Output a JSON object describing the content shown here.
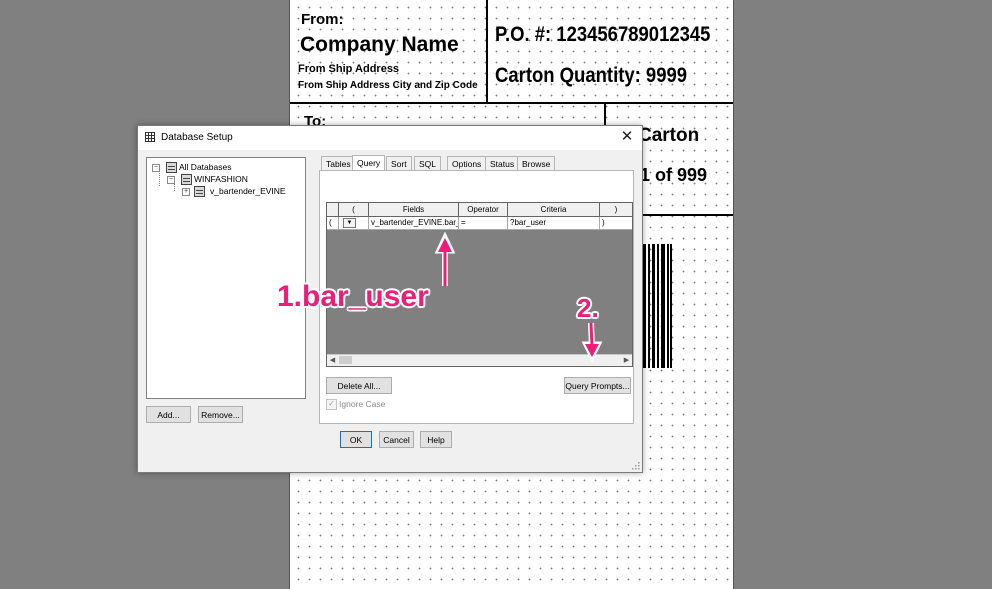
{
  "label": {
    "from_label": "From:",
    "company_name": "Company Name",
    "from_address": "From Ship Address",
    "from_city_zip": "From Ship Address City and Zip Code",
    "po": "P.O. #: 123456789012345",
    "carton_quantity": "Carton Quantity:  9999",
    "to_label": "To:",
    "carton_word": "Carton",
    "carton_count": "1 of 999"
  },
  "dialog": {
    "title": "Database Setup",
    "close_glyph": "✕",
    "tree": [
      {
        "label": "All Databases",
        "expander": "−"
      },
      {
        "label": "WINFASHION",
        "expander": "−"
      },
      {
        "label": "v_bartender_EVINE",
        "expander": "+"
      }
    ],
    "add_button": "Add...",
    "remove_button": "Remove...",
    "tabs": [
      "Tables",
      "Query",
      "Sort",
      "SQL",
      "Options",
      "Status",
      "Browse"
    ],
    "active_tab": "Query",
    "grid": {
      "headers": [
        "(",
        "Fields",
        "Operator",
        "Criteria",
        ")"
      ],
      "row": {
        "open_paren": "(",
        "field": "v_bartender_EVINE.bar_user",
        "operator": "=",
        "criteria": "?bar_user",
        "close_paren": ")"
      }
    },
    "delete_all_button": "Delete All...",
    "query_prompts_button": "Query Prompts...",
    "ignore_case_label": "Ignore Case",
    "ignore_case_checked": true,
    "ok_button": "OK",
    "cancel_button": "Cancel",
    "help_button": "Help"
  },
  "annotations": {
    "step1": "1.bar_user",
    "step2": "2.",
    "color": "#ef1d78"
  }
}
